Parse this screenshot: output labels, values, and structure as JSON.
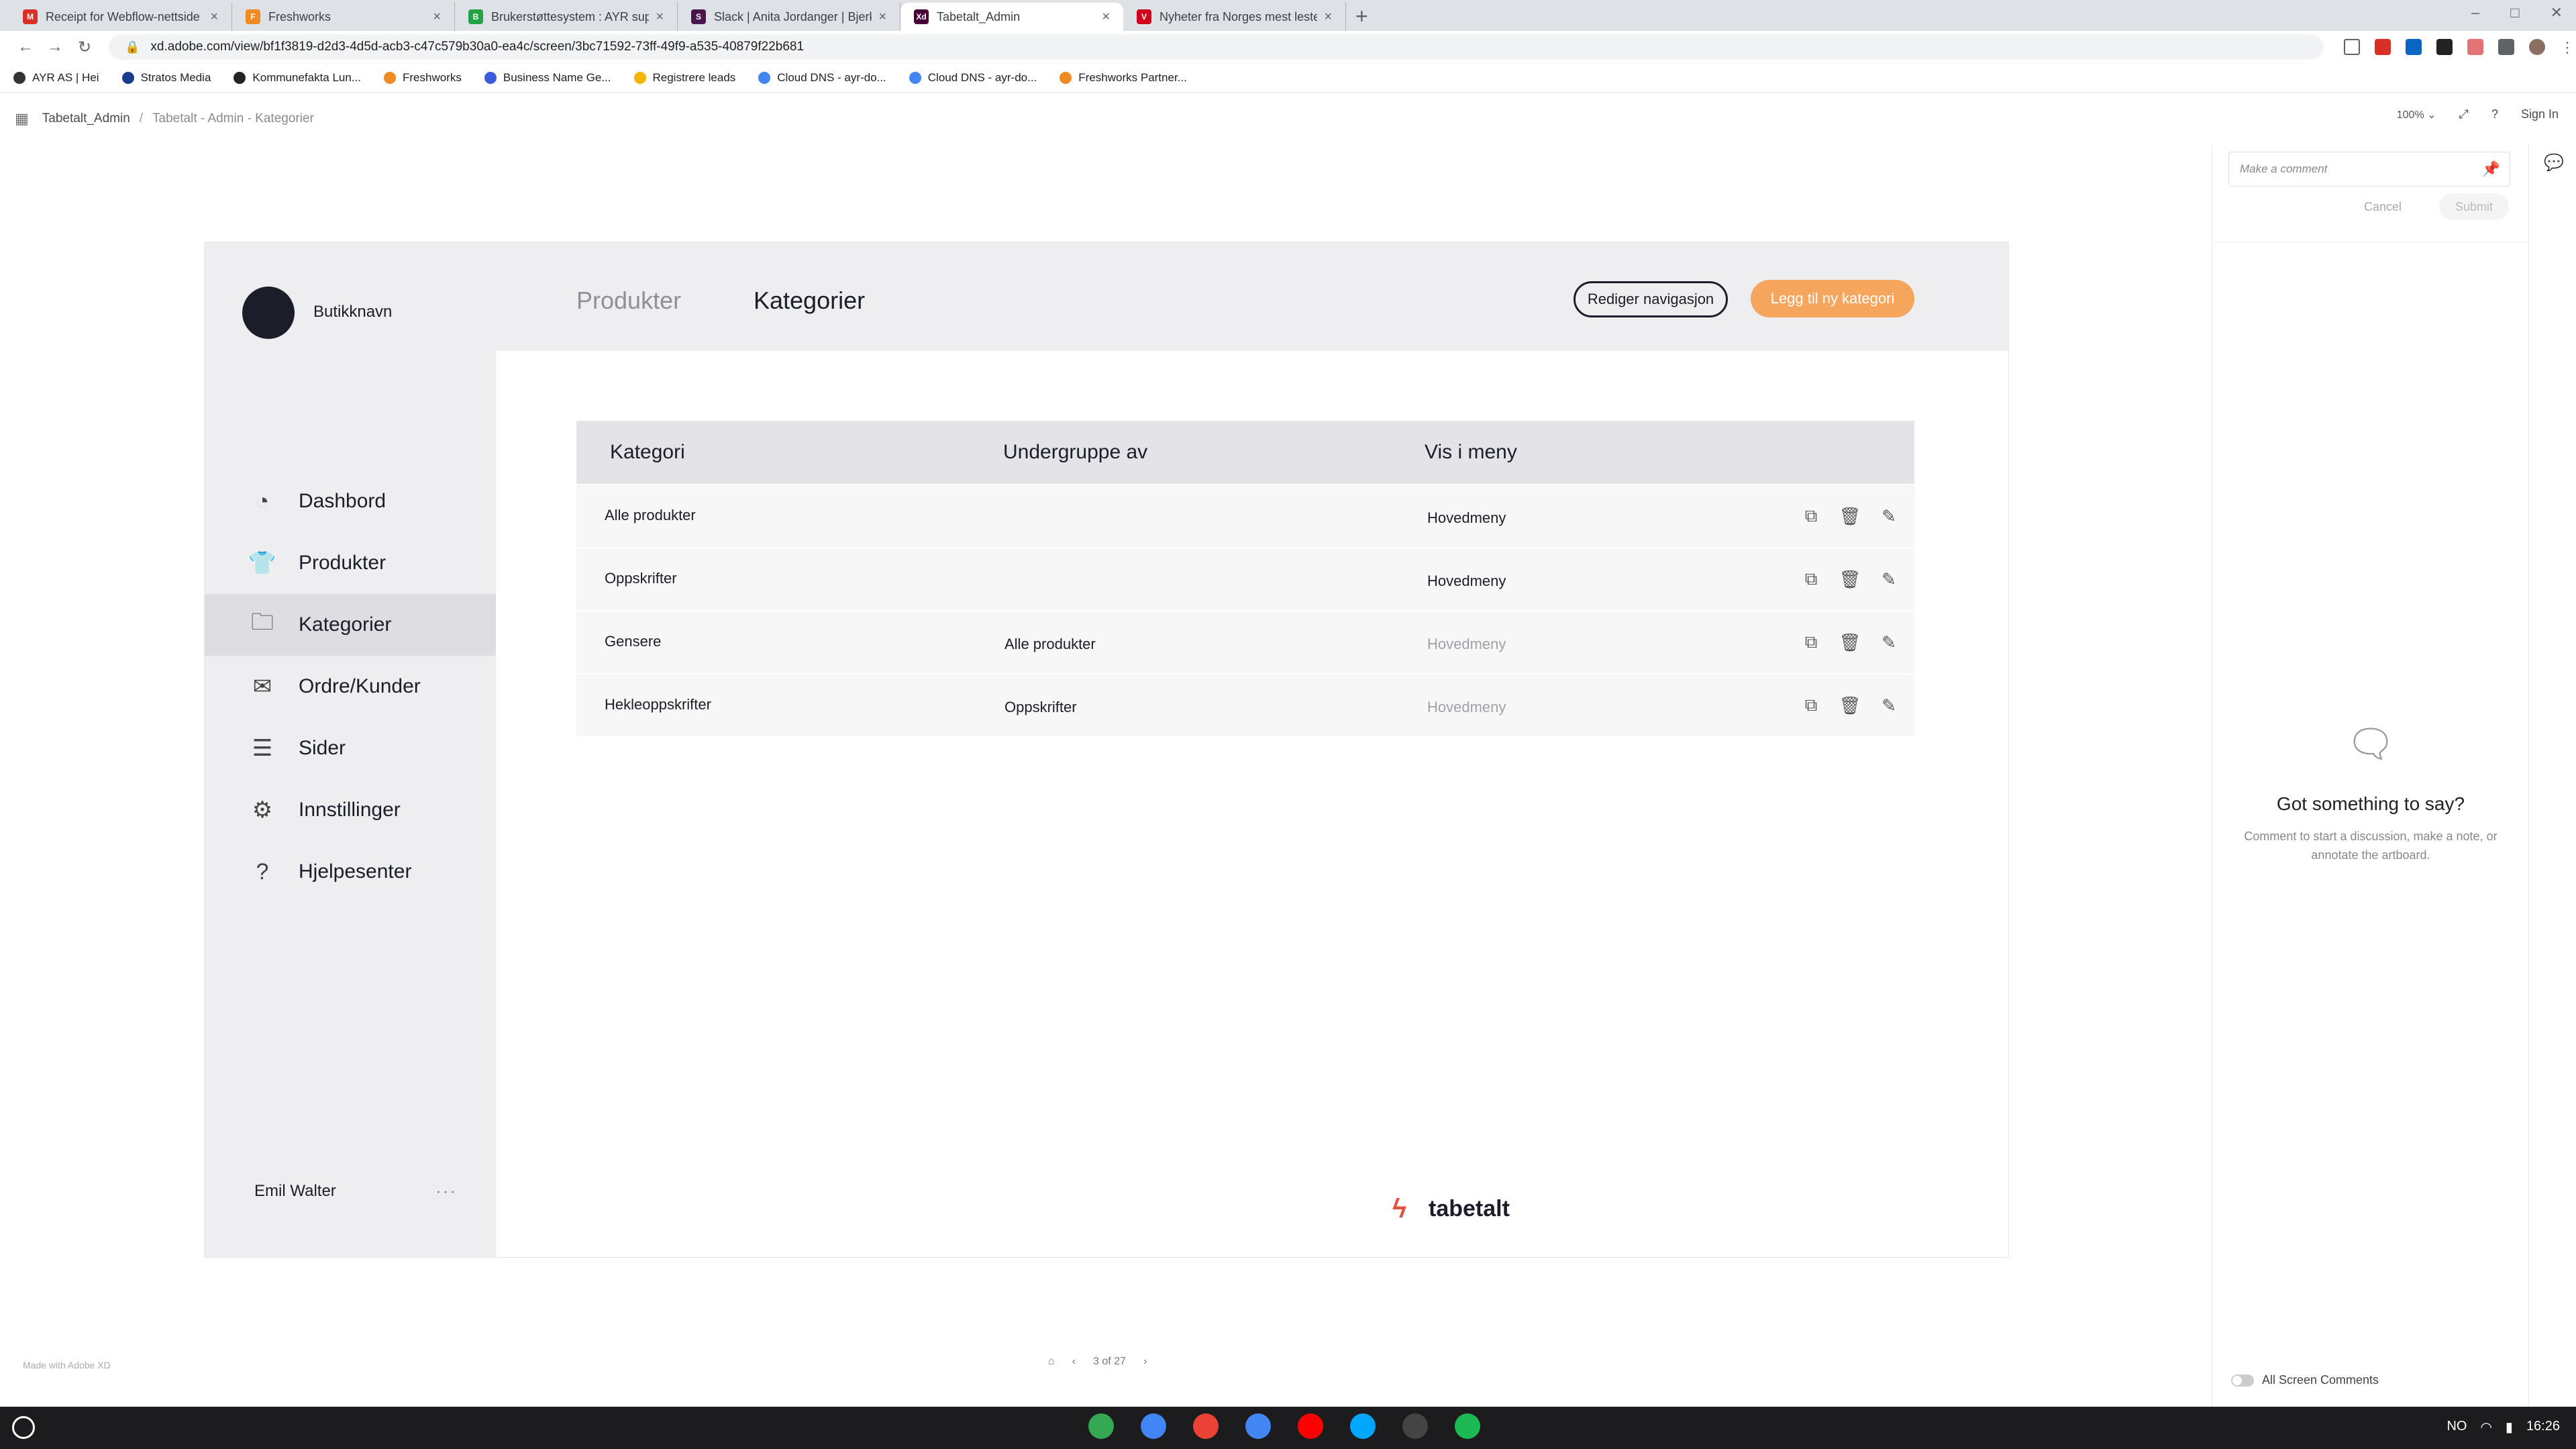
{
  "browser": {
    "tabs": [
      {
        "title": "Receipt for Webflow-nettside - b",
        "color": "#d93025",
        "glyph": "M",
        "active": false
      },
      {
        "title": "Freshworks",
        "color": "#f08a24",
        "glyph": "F",
        "active": false
      },
      {
        "title": "Brukerstøttesystem : AYR suppo",
        "color": "#25a244",
        "glyph": "B",
        "active": false
      },
      {
        "title": "Slack | Anita Jordanger | Bjerk",
        "color": "#4a154b",
        "glyph": "S",
        "active": false
      },
      {
        "title": "Tabetalt_Admin",
        "color": "#470137",
        "glyph": "Xd",
        "active": true
      },
      {
        "title": "Nyheter fra Norges mest leste n",
        "color": "#d0021b",
        "glyph": "V",
        "active": false
      }
    ],
    "url": "xd.adobe.com/view/bf1f3819-d2d3-4d5d-acb3-c47c579b30a0-ea4c/screen/3bc71592-73ff-49f9-a535-40879f22b681",
    "bookmarks": [
      {
        "label": "AYR AS | Hei",
        "color": "#333"
      },
      {
        "label": "Stratos Media",
        "color": "#1a3c8f"
      },
      {
        "label": "Kommunefakta Lun...",
        "color": "#222"
      },
      {
        "label": "Freshworks",
        "color": "#f08a24"
      },
      {
        "label": "Business Name Ge...",
        "color": "#3b5bdb"
      },
      {
        "label": "Registrere leads",
        "color": "#f4b400"
      },
      {
        "label": "Cloud DNS - ayr-do...",
        "color": "#4285f4"
      },
      {
        "label": "Cloud DNS - ayr-do...",
        "color": "#4285f4"
      },
      {
        "label": "Freshworks Partner...",
        "color": "#f08a24"
      }
    ]
  },
  "xd": {
    "breadcrumb_project": "Tabetalt_Admin",
    "breadcrumb_screen": "Tabetalt - Admin - Kategorier",
    "zoom": "100%",
    "sign_in": "Sign In",
    "made_with": "Made with Adobe XD",
    "pager": "3 of 27"
  },
  "app": {
    "shop_name": "Butikknavn",
    "nav": [
      {
        "label": "Dashbord",
        "icon": "gauge-icon",
        "glyph": "◔",
        "active": false
      },
      {
        "label": "Produkter",
        "icon": "shirt-icon",
        "glyph": "👕",
        "active": false
      },
      {
        "label": "Kategorier",
        "icon": "folder-icon",
        "glyph": "🗀",
        "active": true
      },
      {
        "label": "Ordre/Kunder",
        "icon": "inbox-icon",
        "glyph": "✉",
        "active": false
      },
      {
        "label": "Sider",
        "icon": "list-icon",
        "glyph": "☰",
        "active": false
      },
      {
        "label": "Innstillinger",
        "icon": "gear-icon",
        "glyph": "⚙",
        "active": false
      },
      {
        "label": "Hjelpesenter",
        "icon": "help-icon",
        "glyph": "?",
        "active": false
      }
    ],
    "user_name": "Emil Walter",
    "top_tabs": {
      "produkter": "Produkter",
      "kategorier": "Kategorier"
    },
    "btn_edit_nav": "Rediger navigasjon",
    "btn_add_category": "Legg til ny kategori",
    "accent": "#f5a55c",
    "table": {
      "headers": [
        "Kategori",
        "Undergruppe av",
        "Vis i meny"
      ],
      "rows": [
        {
          "kategori": "Alle produkter",
          "undergruppe": "",
          "meny": "Hovedmeny",
          "muted": false
        },
        {
          "kategori": "Oppskrifter",
          "undergruppe": "",
          "meny": "Hovedmeny",
          "muted": false
        },
        {
          "kategori": "Gensere",
          "undergruppe": "Alle produkter",
          "meny": "Hovedmeny",
          "muted": true
        },
        {
          "kategori": "Hekleoppskrifter",
          "undergruppe": "Oppskrifter",
          "meny": "Hovedmeny",
          "muted": true
        }
      ]
    },
    "logo_text": "tabetalt"
  },
  "comments": {
    "placeholder": "Make a comment",
    "cancel": "Cancel",
    "submit": "Submit",
    "heading": "Got something to say?",
    "sub": "Comment to start a discussion, make a note, or annotate the artboard.",
    "all_screen": "All Screen Comments"
  },
  "taskbar": {
    "dock_colors": [
      "#34a853",
      "#4285f4",
      "#ea4335",
      "#4285f4",
      "#ff0000",
      "#00a6ff",
      "#444444",
      "#1db954"
    ],
    "tray": [
      "NO",
      "16:26"
    ]
  }
}
